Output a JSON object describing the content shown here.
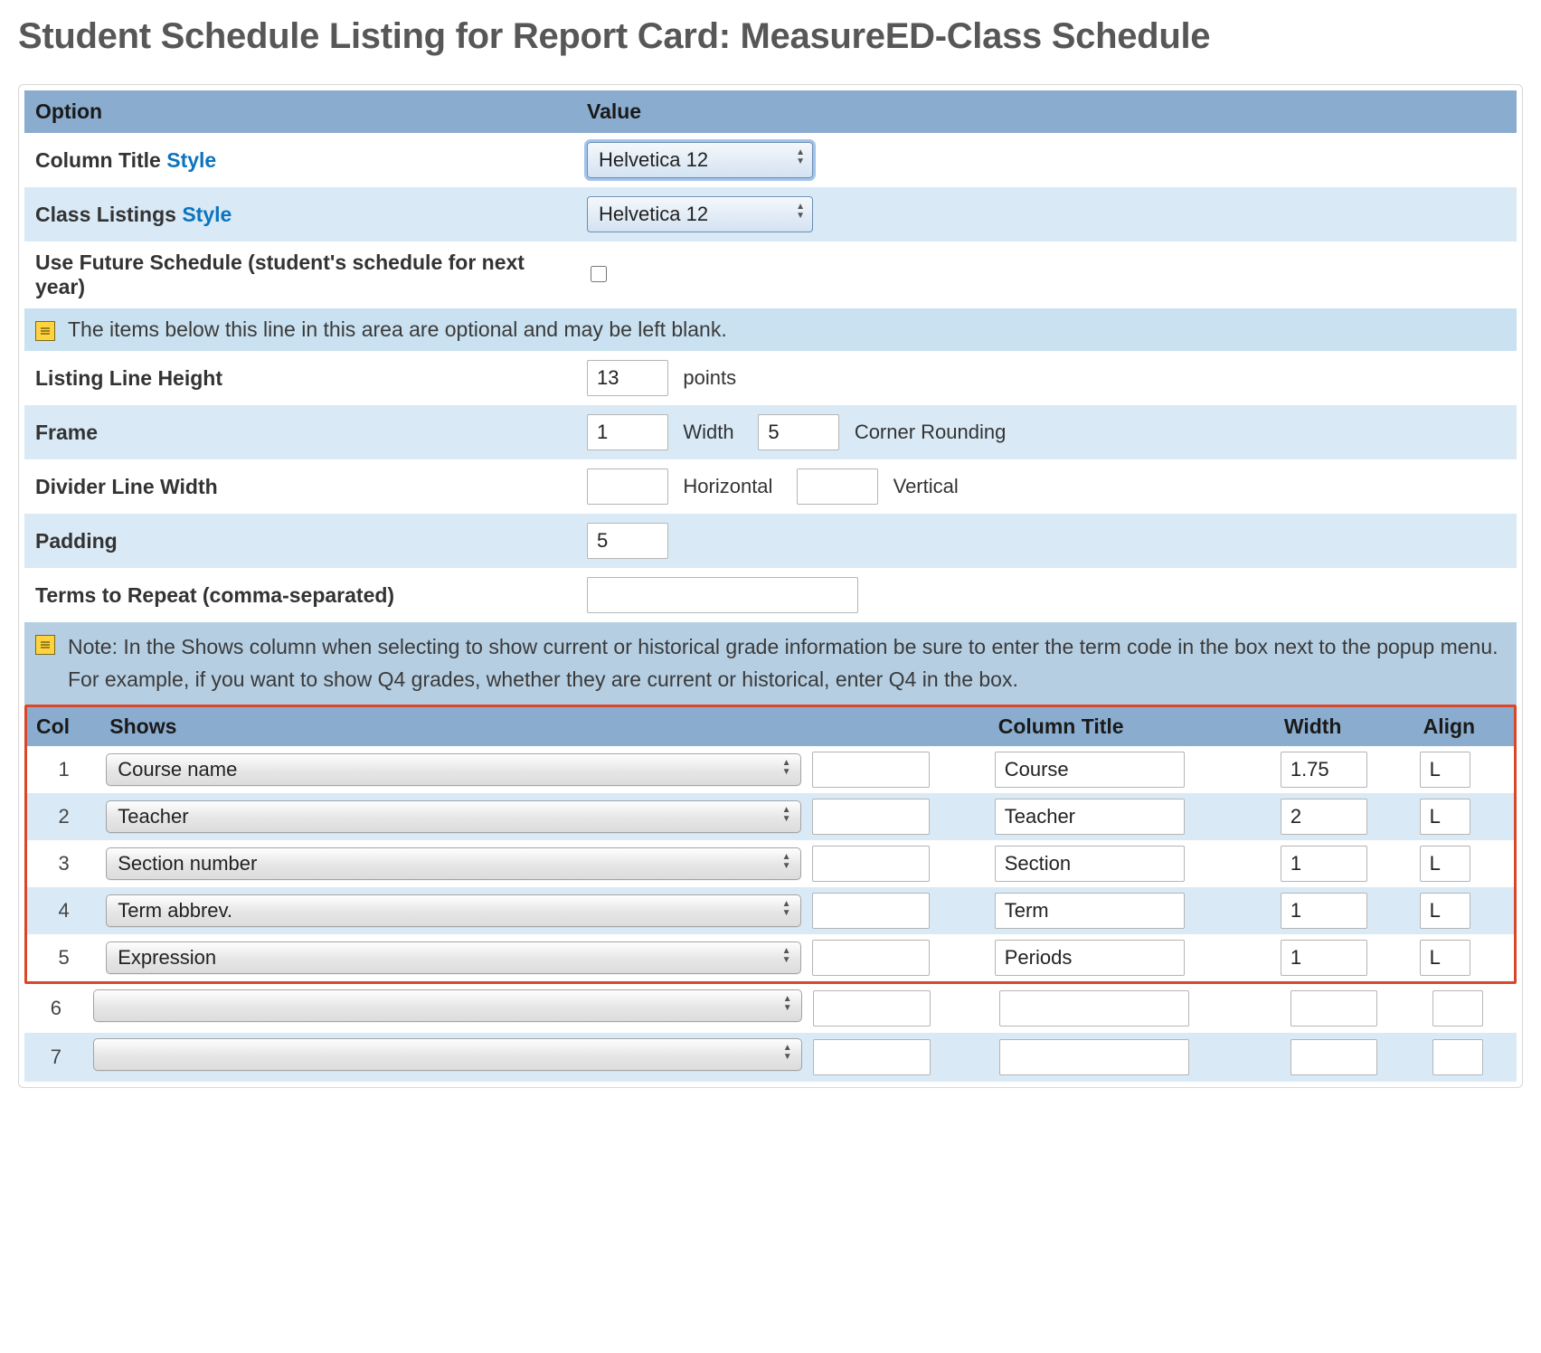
{
  "page_title": "Student Schedule Listing for Report Card: MeasureED-Class Schedule",
  "options_header": {
    "option": "Option",
    "value": "Value"
  },
  "style_link": "Style",
  "rows": {
    "column_title": {
      "label": "Column Title ",
      "select": "Helvetica 12"
    },
    "class_listings": {
      "label": "Class Listings ",
      "select": "Helvetica 12"
    },
    "use_future": {
      "label": "Use Future Schedule (student's schedule for next year)"
    },
    "note1": "The items below this line in this area are optional and may be left blank.",
    "listing_line_height": {
      "label": "Listing Line Height",
      "value": "13",
      "unit": "points"
    },
    "frame": {
      "label": "Frame",
      "width_val": "1",
      "width_lbl": "Width",
      "corner_val": "5",
      "corner_lbl": "Corner Rounding"
    },
    "divider": {
      "label": "Divider Line Width",
      "h_lbl": "Horizontal",
      "v_lbl": "Vertical"
    },
    "padding": {
      "label": "Padding",
      "value": "5"
    },
    "terms": {
      "label": "Terms to Repeat (comma-separated)"
    }
  },
  "big_note": "Note: In the Shows column when selecting to show current or historical grade information be sure to enter the term code in the box next to the popup menu. For example, if you want to show Q4 grades, whether they are current or historical, enter Q4 in the box.",
  "cols_header": {
    "col": "Col",
    "shows": "Shows",
    "title": "Column Title",
    "width": "Width",
    "align": "Align"
  },
  "cols": [
    {
      "n": "1",
      "shows": "Course name",
      "code": "",
      "title": "Course",
      "width": "1.75",
      "align": "L"
    },
    {
      "n": "2",
      "shows": "Teacher",
      "code": "",
      "title": "Teacher",
      "width": "2",
      "align": "L"
    },
    {
      "n": "3",
      "shows": "Section number",
      "code": "",
      "title": "Section",
      "width": "1",
      "align": "L"
    },
    {
      "n": "4",
      "shows": "Term abbrev.",
      "code": "",
      "title": "Term",
      "width": "1",
      "align": "L"
    },
    {
      "n": "5",
      "shows": "Expression",
      "code": "",
      "title": "Periods",
      "width": "1",
      "align": "L"
    },
    {
      "n": "6",
      "shows": "",
      "code": "",
      "title": "",
      "width": "",
      "align": ""
    },
    {
      "n": "7",
      "shows": "",
      "code": "",
      "title": "",
      "width": "",
      "align": ""
    }
  ]
}
